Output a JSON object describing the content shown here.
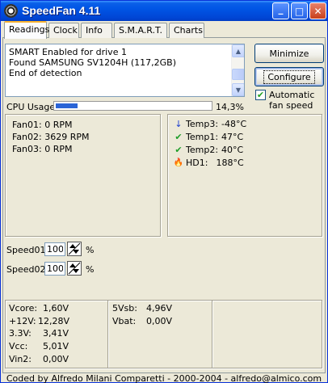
{
  "window": {
    "title": "SpeedFan 4.11"
  },
  "titlebar_buttons": {
    "minimize": "_",
    "maximize": "□",
    "close": "✕"
  },
  "tabs": [
    {
      "label": "Readings",
      "active": true
    },
    {
      "label": "Clock",
      "active": false
    },
    {
      "label": "Info",
      "active": false
    },
    {
      "label": "S.M.A.R.T.",
      "active": false
    },
    {
      "label": "Charts",
      "active": false
    }
  ],
  "log": {
    "lines": [
      "SMART Enabled for drive 1",
      "Found SAMSUNG SV1204H (117,2GB)",
      "End of detection"
    ]
  },
  "buttons": {
    "minimize": "Minimize",
    "configure": "Configure"
  },
  "auto_fan_speed": {
    "label": "Automatic fan speed",
    "checked": true,
    "check_glyph": "✔"
  },
  "cpu": {
    "label": "CPU Usage",
    "value": "14,3%",
    "fraction": 0.143
  },
  "fans": [
    {
      "label": "Fan01:",
      "value": "0 RPM"
    },
    {
      "label": "Fan02:",
      "value": "3629 RPM"
    },
    {
      "label": "Fan03:",
      "value": "0 RPM"
    }
  ],
  "temps": [
    {
      "label": "Temp3:",
      "value": "-48°C",
      "icon": "arrow-down-icon",
      "glyph": "↓",
      "color": "#1d3fcf"
    },
    {
      "label": "Temp1:",
      "value": "47°C",
      "icon": "check-icon",
      "glyph": "✔",
      "color": "#1f9e2a"
    },
    {
      "label": "Temp2:",
      "value": "40°C",
      "icon": "check-icon",
      "glyph": "✔",
      "color": "#1f9e2a"
    },
    {
      "label": "HD1:",
      "value": "188°C",
      "icon": "flame-icon",
      "glyph": "🔥",
      "color": "#e8590c"
    }
  ],
  "speeds": [
    {
      "label": "Speed01:",
      "value": "100",
      "unit": "%"
    },
    {
      "label": "Speed02:",
      "value": "100",
      "unit": "%"
    }
  ],
  "voltages_left": [
    {
      "label": "Vcore:",
      "value": "1,60V"
    },
    {
      "label": "+12V:",
      "value": "12,28V"
    },
    {
      "label": "3.3V:",
      "value": "3,41V"
    },
    {
      "label": "Vcc:",
      "value": "5,01V"
    },
    {
      "label": "Vin2:",
      "value": "0,00V"
    }
  ],
  "voltages_right": [
    {
      "label": "5Vsb:",
      "value": "4,96V"
    },
    {
      "label": "Vbat:",
      "value": "0,00V"
    }
  ],
  "status": {
    "text": "Coded by Alfredo Milani Comparetti - 2000-2004 - alfredo@almico.com"
  }
}
